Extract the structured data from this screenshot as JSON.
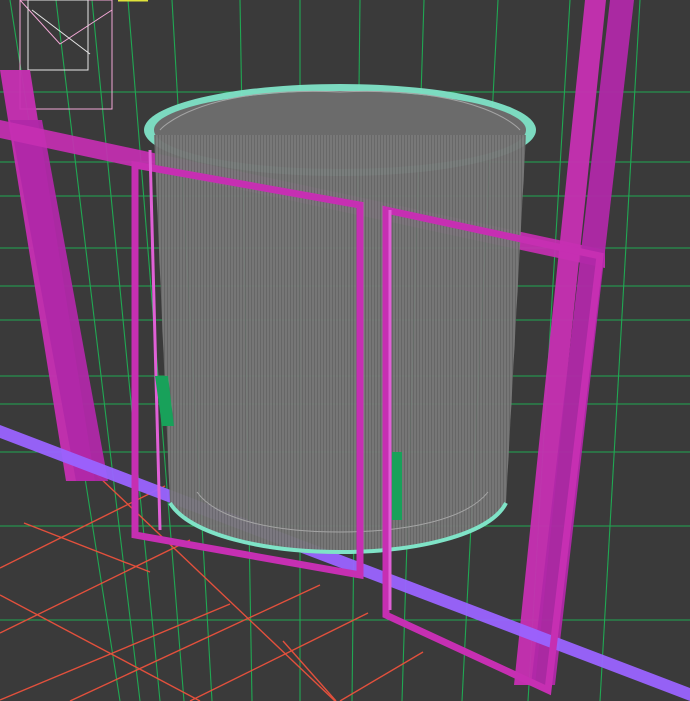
{
  "viewport": {
    "background_color": "#3a3a3a",
    "view_mode": "wireframe",
    "grid_visible": true
  },
  "colors": {
    "background": "#3a3a3a",
    "grid_green": "#1fae55",
    "floor_red": "#e2503c",
    "frame_magenta": "#c62fb2",
    "frame_magenta_light": "#e060d6",
    "cylinder_fill": "#6b6b6b",
    "cylinder_mesh": "#a4a4a4",
    "cylinder_edge": "#7fe3c7",
    "handle_green": "#18a15a",
    "base_purple": "#9a63ff",
    "white_wire": "#e6e6e6",
    "pink_wire": "#f3a7d6",
    "yellow_wire": "#e0e33a"
  },
  "objects": [
    {
      "name": "revolving-door-cylinder",
      "type": "mesh"
    },
    {
      "name": "door-frame",
      "type": "mesh"
    },
    {
      "name": "door-handle-left",
      "type": "mesh"
    },
    {
      "name": "door-handle-right",
      "type": "mesh"
    },
    {
      "name": "floor-grid",
      "type": "grid"
    },
    {
      "name": "background-furniture",
      "type": "mesh"
    }
  ]
}
